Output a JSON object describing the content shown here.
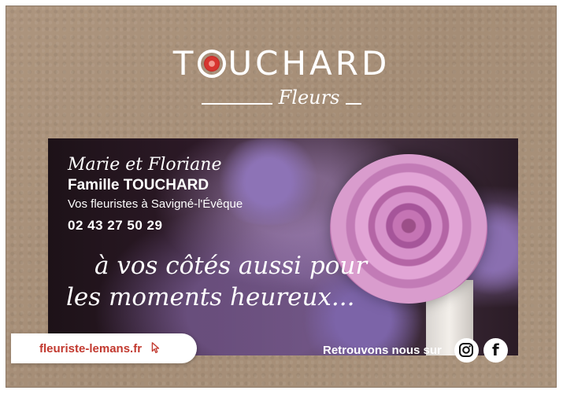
{
  "brand": {
    "name_part1": "T",
    "name_part2": "UCHARD",
    "subtitle": "Fleurs"
  },
  "card": {
    "script_names": "Marie et Floriane",
    "family": "Famille TOUCHARD",
    "description": "Vos fleuristes à Savigné-l'Évêque",
    "phone": "02 43 27 50 29",
    "tagline_line1": "à vos côtés aussi pour",
    "tagline_line2": "les moments heureux..."
  },
  "footer": {
    "website": "fleuriste-lemans.fr",
    "social_label": "Retrouvons nous sur",
    "social_icons": [
      "instagram-icon",
      "facebook-icon"
    ],
    "facebook_glyph": "f"
  },
  "colors": {
    "kraft_background": "#a9927c",
    "accent_red": "#c2392f",
    "text_white": "#ffffff"
  }
}
